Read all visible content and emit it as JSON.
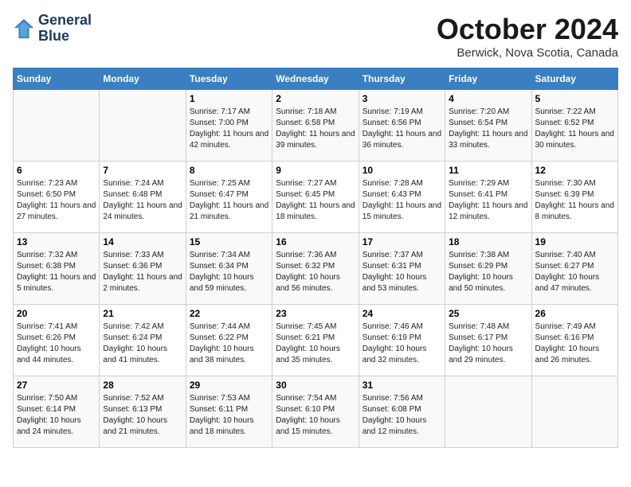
{
  "header": {
    "logo_line1": "General",
    "logo_line2": "Blue",
    "month_title": "October 2024",
    "location": "Berwick, Nova Scotia, Canada"
  },
  "days_of_week": [
    "Sunday",
    "Monday",
    "Tuesday",
    "Wednesday",
    "Thursday",
    "Friday",
    "Saturday"
  ],
  "weeks": [
    [
      {
        "day": "",
        "info": ""
      },
      {
        "day": "",
        "info": ""
      },
      {
        "day": "1",
        "info": "Sunrise: 7:17 AM\nSunset: 7:00 PM\nDaylight: 11 hours and 42 minutes."
      },
      {
        "day": "2",
        "info": "Sunrise: 7:18 AM\nSunset: 6:58 PM\nDaylight: 11 hours and 39 minutes."
      },
      {
        "day": "3",
        "info": "Sunrise: 7:19 AM\nSunset: 6:56 PM\nDaylight: 11 hours and 36 minutes."
      },
      {
        "day": "4",
        "info": "Sunrise: 7:20 AM\nSunset: 6:54 PM\nDaylight: 11 hours and 33 minutes."
      },
      {
        "day": "5",
        "info": "Sunrise: 7:22 AM\nSunset: 6:52 PM\nDaylight: 11 hours and 30 minutes."
      }
    ],
    [
      {
        "day": "6",
        "info": "Sunrise: 7:23 AM\nSunset: 6:50 PM\nDaylight: 11 hours and 27 minutes."
      },
      {
        "day": "7",
        "info": "Sunrise: 7:24 AM\nSunset: 6:48 PM\nDaylight: 11 hours and 24 minutes."
      },
      {
        "day": "8",
        "info": "Sunrise: 7:25 AM\nSunset: 6:47 PM\nDaylight: 11 hours and 21 minutes."
      },
      {
        "day": "9",
        "info": "Sunrise: 7:27 AM\nSunset: 6:45 PM\nDaylight: 11 hours and 18 minutes."
      },
      {
        "day": "10",
        "info": "Sunrise: 7:28 AM\nSunset: 6:43 PM\nDaylight: 11 hours and 15 minutes."
      },
      {
        "day": "11",
        "info": "Sunrise: 7:29 AM\nSunset: 6:41 PM\nDaylight: 11 hours and 12 minutes."
      },
      {
        "day": "12",
        "info": "Sunrise: 7:30 AM\nSunset: 6:39 PM\nDaylight: 11 hours and 8 minutes."
      }
    ],
    [
      {
        "day": "13",
        "info": "Sunrise: 7:32 AM\nSunset: 6:38 PM\nDaylight: 11 hours and 5 minutes."
      },
      {
        "day": "14",
        "info": "Sunrise: 7:33 AM\nSunset: 6:36 PM\nDaylight: 11 hours and 2 minutes."
      },
      {
        "day": "15",
        "info": "Sunrise: 7:34 AM\nSunset: 6:34 PM\nDaylight: 10 hours and 59 minutes."
      },
      {
        "day": "16",
        "info": "Sunrise: 7:36 AM\nSunset: 6:32 PM\nDaylight: 10 hours and 56 minutes."
      },
      {
        "day": "17",
        "info": "Sunrise: 7:37 AM\nSunset: 6:31 PM\nDaylight: 10 hours and 53 minutes."
      },
      {
        "day": "18",
        "info": "Sunrise: 7:38 AM\nSunset: 6:29 PM\nDaylight: 10 hours and 50 minutes."
      },
      {
        "day": "19",
        "info": "Sunrise: 7:40 AM\nSunset: 6:27 PM\nDaylight: 10 hours and 47 minutes."
      }
    ],
    [
      {
        "day": "20",
        "info": "Sunrise: 7:41 AM\nSunset: 6:26 PM\nDaylight: 10 hours and 44 minutes."
      },
      {
        "day": "21",
        "info": "Sunrise: 7:42 AM\nSunset: 6:24 PM\nDaylight: 10 hours and 41 minutes."
      },
      {
        "day": "22",
        "info": "Sunrise: 7:44 AM\nSunset: 6:22 PM\nDaylight: 10 hours and 38 minutes."
      },
      {
        "day": "23",
        "info": "Sunrise: 7:45 AM\nSunset: 6:21 PM\nDaylight: 10 hours and 35 minutes."
      },
      {
        "day": "24",
        "info": "Sunrise: 7:46 AM\nSunset: 6:19 PM\nDaylight: 10 hours and 32 minutes."
      },
      {
        "day": "25",
        "info": "Sunrise: 7:48 AM\nSunset: 6:17 PM\nDaylight: 10 hours and 29 minutes."
      },
      {
        "day": "26",
        "info": "Sunrise: 7:49 AM\nSunset: 6:16 PM\nDaylight: 10 hours and 26 minutes."
      }
    ],
    [
      {
        "day": "27",
        "info": "Sunrise: 7:50 AM\nSunset: 6:14 PM\nDaylight: 10 hours and 24 minutes."
      },
      {
        "day": "28",
        "info": "Sunrise: 7:52 AM\nSunset: 6:13 PM\nDaylight: 10 hours and 21 minutes."
      },
      {
        "day": "29",
        "info": "Sunrise: 7:53 AM\nSunset: 6:11 PM\nDaylight: 10 hours and 18 minutes."
      },
      {
        "day": "30",
        "info": "Sunrise: 7:54 AM\nSunset: 6:10 PM\nDaylight: 10 hours and 15 minutes."
      },
      {
        "day": "31",
        "info": "Sunrise: 7:56 AM\nSunset: 6:08 PM\nDaylight: 10 hours and 12 minutes."
      },
      {
        "day": "",
        "info": ""
      },
      {
        "day": "",
        "info": ""
      }
    ]
  ]
}
